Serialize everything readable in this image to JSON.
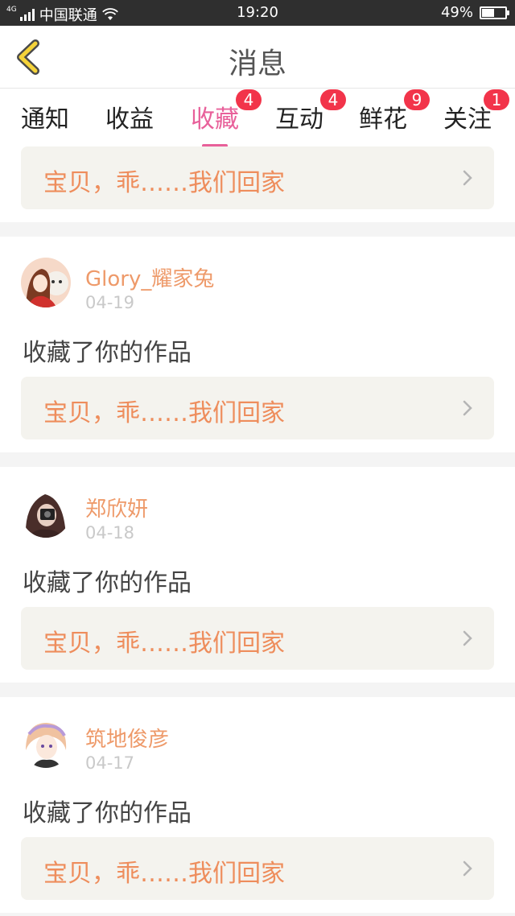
{
  "status_bar": {
    "network": "4G",
    "carrier": "中国联通",
    "time": "19:20",
    "battery": "49%",
    "battery_level": 0.49
  },
  "header": {
    "title": "消息",
    "back_icon": "chevron-left-icon"
  },
  "tabs": [
    {
      "label": "通知",
      "badge": null,
      "active": false
    },
    {
      "label": "收益",
      "badge": null,
      "active": false
    },
    {
      "label": "收藏",
      "badge": "4",
      "active": true
    },
    {
      "label": "互动",
      "badge": "4",
      "active": false
    },
    {
      "label": "鲜花",
      "badge": "9",
      "active": false
    },
    {
      "label": "关注",
      "badge": "1",
      "active": false
    }
  ],
  "top_card": {
    "work_title": "宝贝，乖……我们回家"
  },
  "items": [
    {
      "username": "Glory_耀家兔",
      "date": "04-19",
      "action": "收藏了你的作品",
      "work_title": "宝贝，乖……我们回家"
    },
    {
      "username": "郑欣妍",
      "date": "04-18",
      "action": "收藏了你的作品",
      "work_title": "宝贝，乖……我们回家"
    },
    {
      "username": "筑地俊彦",
      "date": "04-17",
      "action": "收藏了你的作品",
      "work_title": "宝贝，乖……我们回家"
    }
  ],
  "colors": {
    "accent_pink": "#e8609a",
    "badge_red": "#f2344a",
    "username_orange": "#ee9a6a",
    "work_title_orange": "#ee8d5c",
    "back_yellow": "#f5d33a"
  }
}
